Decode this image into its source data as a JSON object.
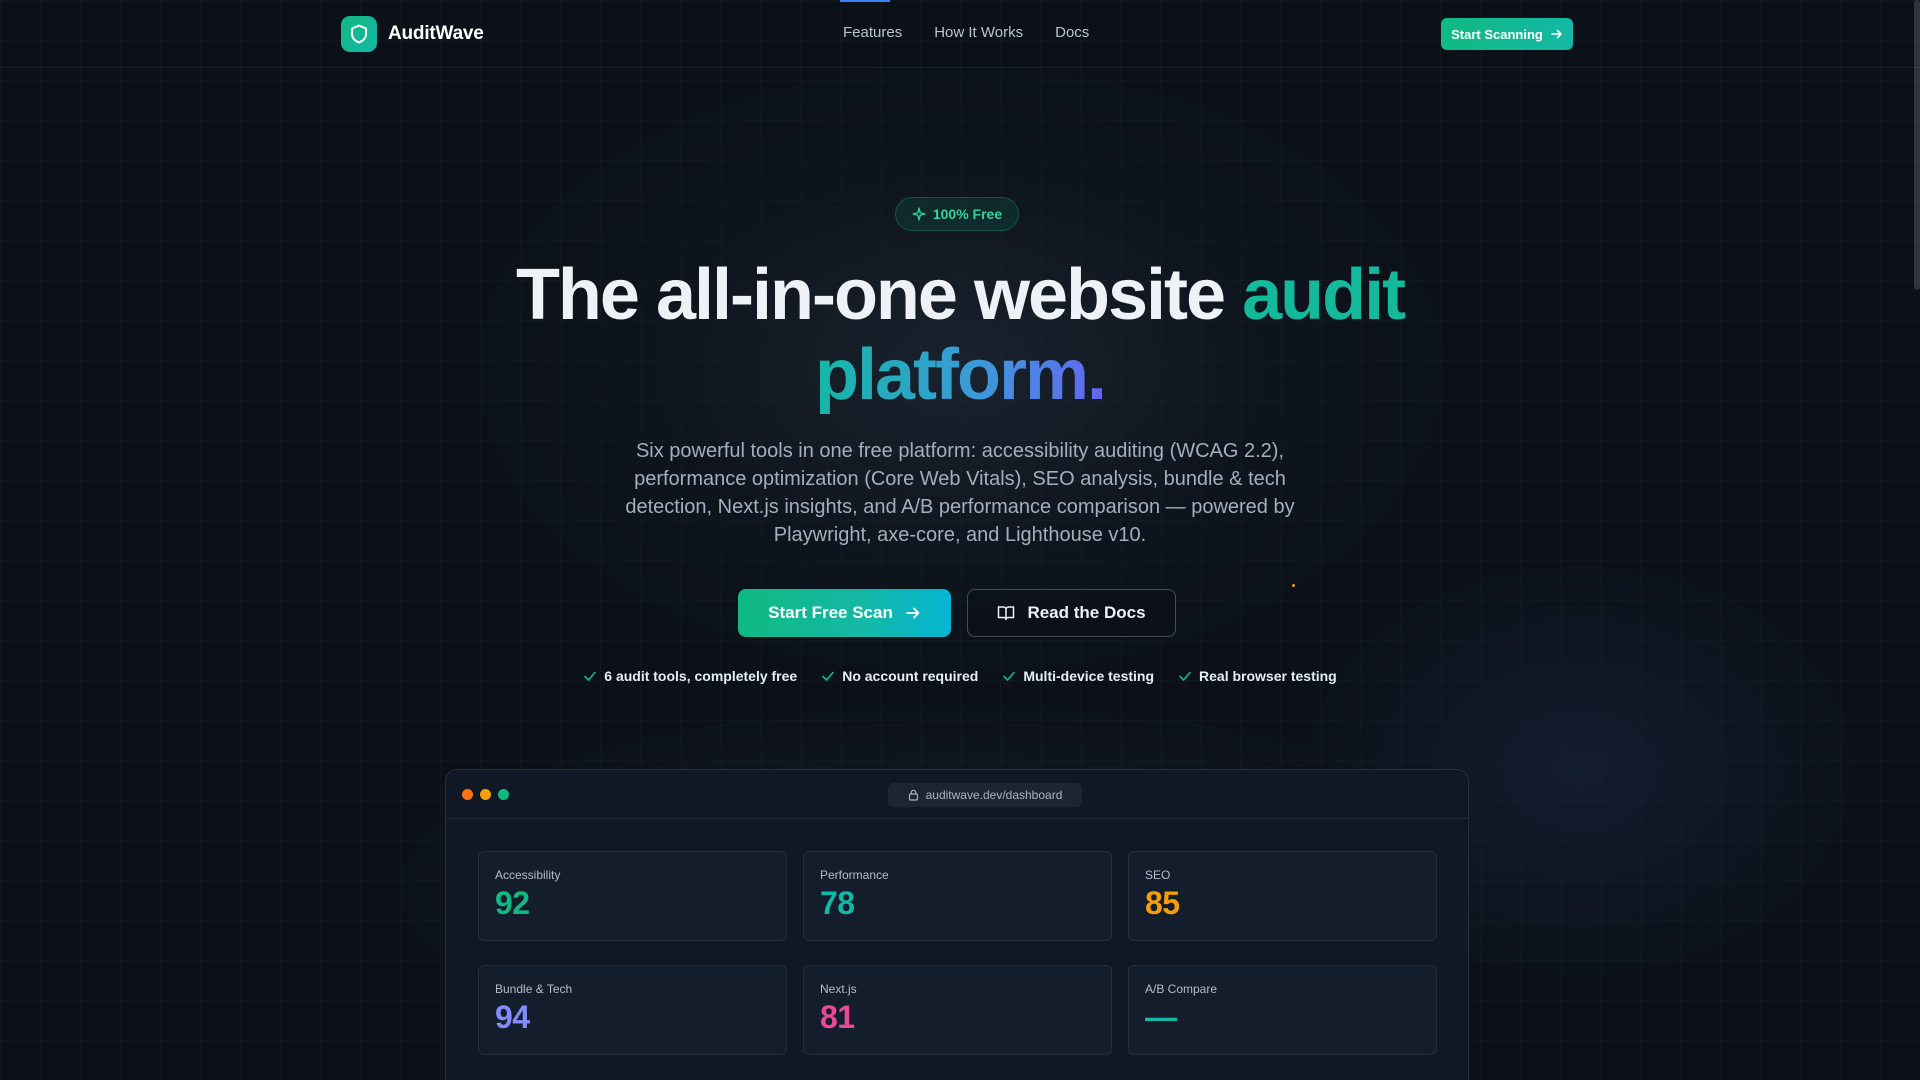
{
  "header": {
    "brand": "AuditWave",
    "nav": [
      "Features",
      "How It Works",
      "Docs"
    ],
    "cta": "Start Scanning"
  },
  "hero": {
    "badge": "100% Free",
    "title_plain": "The all-in-one website ",
    "title_accent1": "audit",
    "title_accent2": "platform.",
    "subtitle": "Six powerful tools in one free platform: accessibility auditing (WCAG 2.2), performance optimization (Core Web Vitals), SEO analysis, bundle & tech detection, Next.js insights, and A/B performance comparison — powered by Playwright, axe-core, and Lighthouse v10.",
    "primary_button": "Start Free Scan",
    "secondary_button": "Read the Docs",
    "checks": [
      "6 audit tools, completely free",
      "No account required",
      "Multi-device testing",
      "Real browser testing"
    ]
  },
  "dashboard": {
    "url": "auditwave.dev/dashboard",
    "cards": [
      {
        "label": "Accessibility",
        "value": "92",
        "color": "#10b981"
      },
      {
        "label": "Performance",
        "value": "78",
        "color": "#14b8a6"
      },
      {
        "label": "SEO",
        "value": "85",
        "color": "#f59e0b"
      },
      {
        "label": "Bundle & Tech",
        "value": "94",
        "color": "#818cf8"
      },
      {
        "label": "Next.js",
        "value": "81",
        "color": "#ec4899"
      },
      {
        "label": "A/B Compare",
        "value": "—",
        "color": "#14b8a6"
      }
    ]
  },
  "colors": {
    "accent": "#10b981",
    "background": "#0c1119"
  }
}
